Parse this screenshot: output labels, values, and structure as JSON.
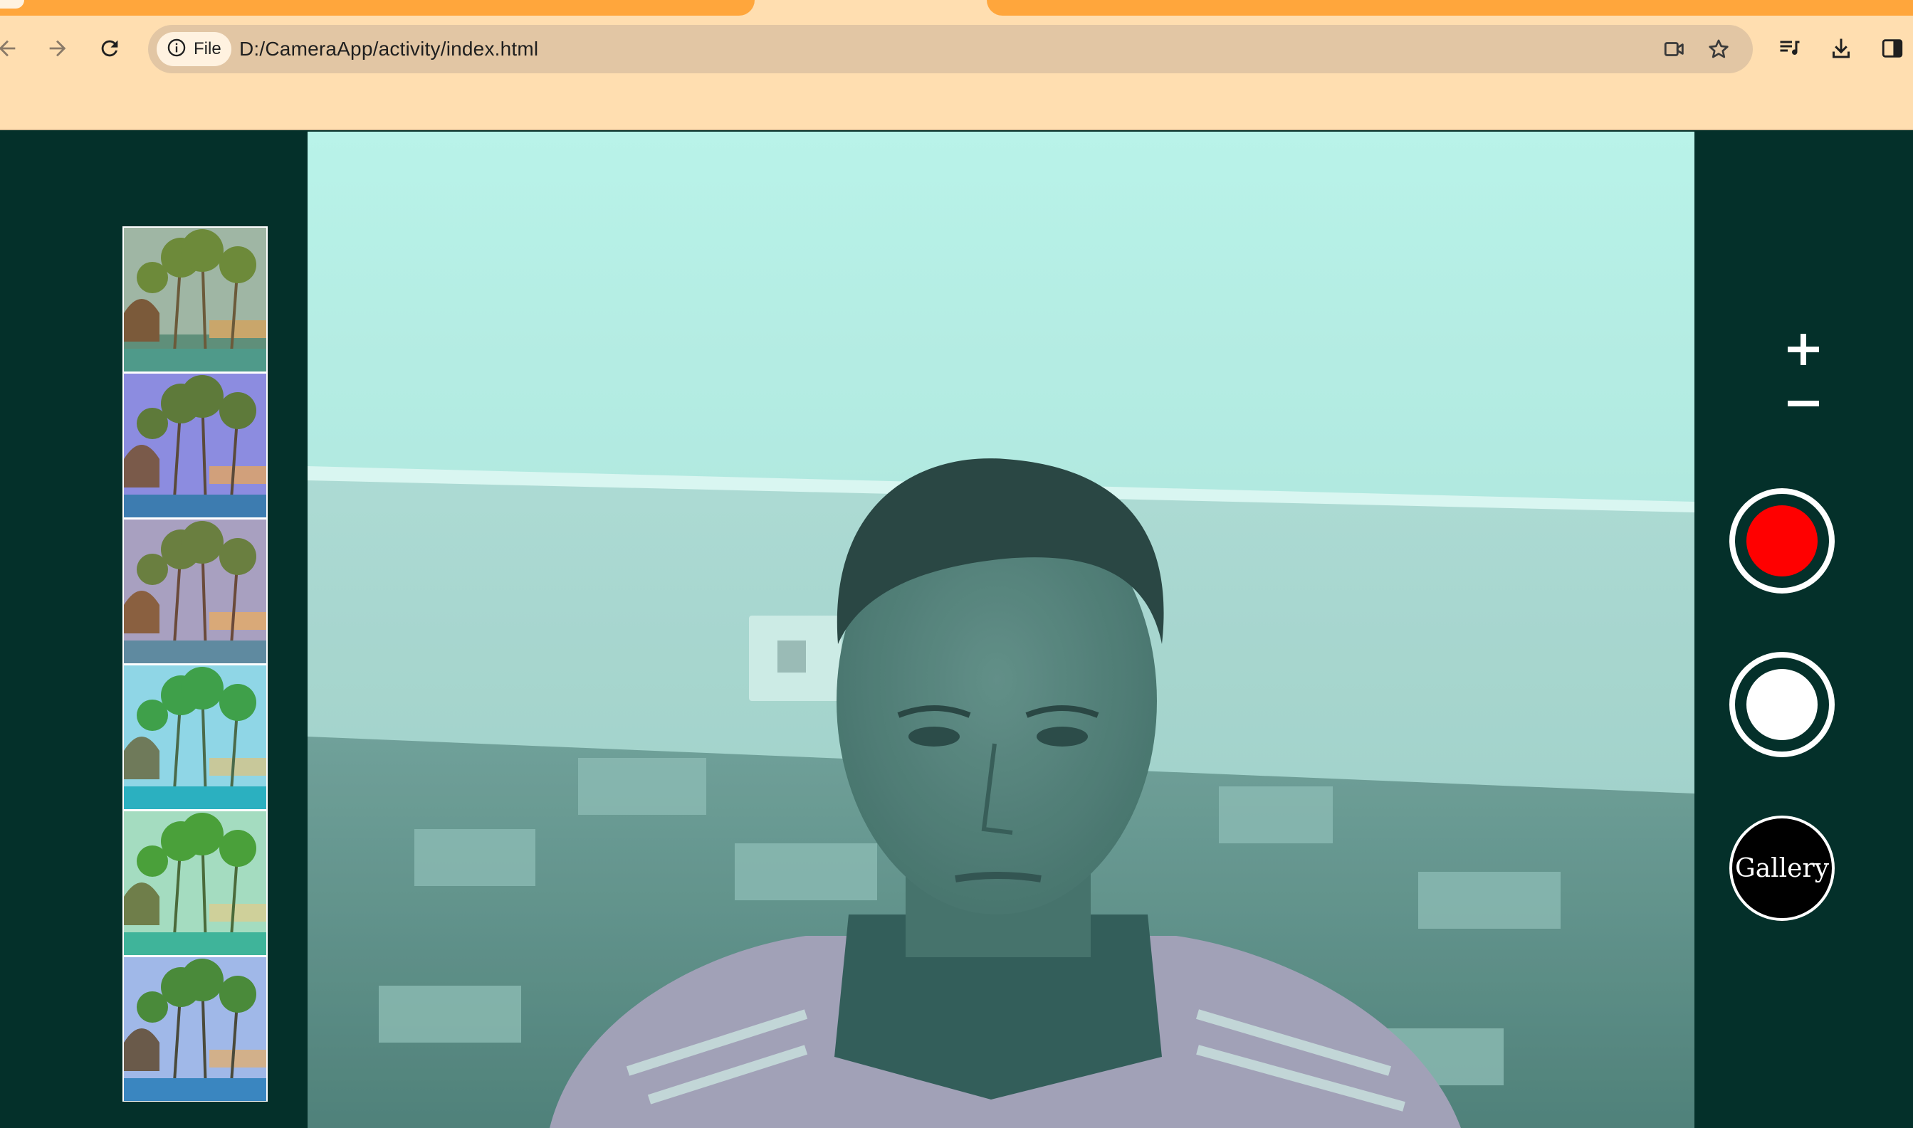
{
  "browser": {
    "site_info_label": "File",
    "url": "D:/CameraApp/activity/index.html",
    "icons": [
      "back-icon",
      "forward-icon",
      "reload-icon",
      "info-icon",
      "camera-indicator-icon",
      "bookmark-star-icon",
      "media-controls-icon",
      "download-icon",
      "side-panel-icon"
    ]
  },
  "app": {
    "filter_thumbnails": [
      {
        "name": "sepia-warm"
      },
      {
        "name": "purple-tint"
      },
      {
        "name": "vintage"
      },
      {
        "name": "bright-cyan"
      },
      {
        "name": "green-tint"
      },
      {
        "name": "cool-blue"
      }
    ],
    "controls": {
      "zoom_in_symbol": "+",
      "zoom_out_symbol": "−",
      "gallery_label": "Gallery"
    },
    "colors": {
      "background": "#04302a",
      "record": "#ff0000",
      "chrome": "#ffdeb0",
      "tab_accent": "#ffa63c"
    }
  }
}
